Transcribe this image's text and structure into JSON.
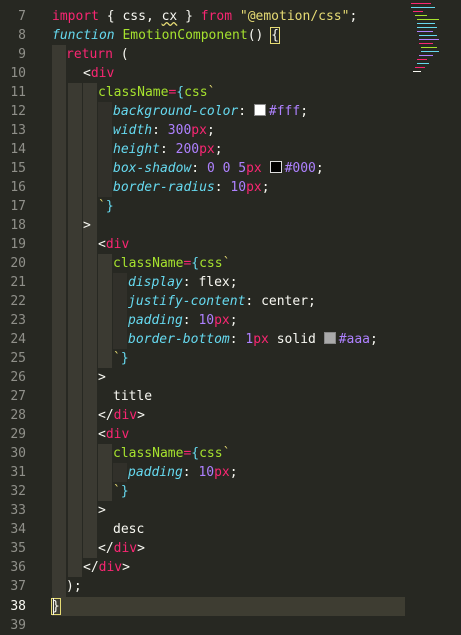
{
  "editor": {
    "current_line": 38,
    "line_numbers": [
      "7",
      "8",
      "9",
      "10",
      "11",
      "12",
      "13",
      "14",
      "15",
      "16",
      "17",
      "18",
      "19",
      "20",
      "21",
      "22",
      "23",
      "24",
      "25",
      "26",
      "27",
      "28",
      "29",
      "30",
      "31",
      "32",
      "33",
      "34",
      "35",
      "36",
      "37",
      "38",
      "39"
    ],
    "lines": {
      "l7": {
        "import": "import",
        "b1": " { ",
        "css": "css",
        "comma": ", ",
        "cx": "cx",
        "b2": " } ",
        "from": "from",
        "sp": " ",
        "mod": "\"@emotion/css\"",
        "semi": ";"
      },
      "l8": {
        "function": "function",
        "name": " EmotionComponent",
        "paren": "() ",
        "brace": "{"
      },
      "l9": {
        "return": "return",
        "paren": " ("
      },
      "l10": {
        "lt": "<",
        "tag": "div"
      },
      "l11": {
        "attr": "className",
        "eq": "=",
        "ob": "{",
        "css": "css",
        "bt": "`"
      },
      "l12": {
        "prop": "background-color",
        "colon": ": ",
        "color_value": "#fff",
        "semi": ";"
      },
      "l13": {
        "prop": "width",
        "colon": ": ",
        "num": "300",
        "unit": "px",
        "semi": ";"
      },
      "l14": {
        "prop": "height",
        "colon": ": ",
        "num": "200",
        "unit": "px",
        "semi": ";"
      },
      "l15": {
        "prop": "box-shadow",
        "colon": ": ",
        "v1": "0 0 ",
        "num": "5",
        "unit": "px ",
        "color_value": "#000",
        "semi": ";"
      },
      "l16": {
        "prop": "border-radius",
        "colon": ": ",
        "num": "10",
        "unit": "px",
        "semi": ";"
      },
      "l17": {
        "bt": "`",
        "cb": "}"
      },
      "l18": {
        "gt": ">"
      },
      "l19": {
        "lt": "<",
        "tag": "div"
      },
      "l20": {
        "attr": "className",
        "eq": "=",
        "ob": "{",
        "css": "css",
        "bt": "`"
      },
      "l21": {
        "prop": "display",
        "colon": ": ",
        "val": "flex",
        "semi": ";"
      },
      "l22": {
        "prop": "justify-content",
        "colon": ": ",
        "val": "center",
        "semi": ";"
      },
      "l23": {
        "prop": "padding",
        "colon": ": ",
        "num": "10",
        "unit": "px",
        "semi": ";"
      },
      "l24": {
        "prop": "border-bottom",
        "colon": ": ",
        "num": "1",
        "unit": "px",
        "val": " solid ",
        "color_value": "#aaa",
        "semi": ";"
      },
      "l25": {
        "bt": "`",
        "cb": "}"
      },
      "l26": {
        "gt": ">"
      },
      "l27": {
        "text": "title"
      },
      "l28": {
        "lt": "</",
        "tag": "div",
        "gt": ">"
      },
      "l29": {
        "lt": "<",
        "tag": "div"
      },
      "l30": {
        "attr": "className",
        "eq": "=",
        "ob": "{",
        "css": "css",
        "bt": "`"
      },
      "l31": {
        "prop": "padding",
        "colon": ": ",
        "num": "10",
        "unit": "px",
        "semi": ";"
      },
      "l32": {
        "bt": "`",
        "cb": "}"
      },
      "l33": {
        "gt": ">"
      },
      "l34": {
        "text": "desc"
      },
      "l35": {
        "lt": "</",
        "tag": "div",
        "gt": ">"
      },
      "l36": {
        "lt": "</",
        "tag": "div",
        "gt": ">"
      },
      "l37": {
        "paren": ");"
      },
      "l38": {
        "brace": "}"
      }
    },
    "swatches": {
      "white": "#ffffff",
      "black": "#000000",
      "gray": "#aaaaaa"
    }
  }
}
